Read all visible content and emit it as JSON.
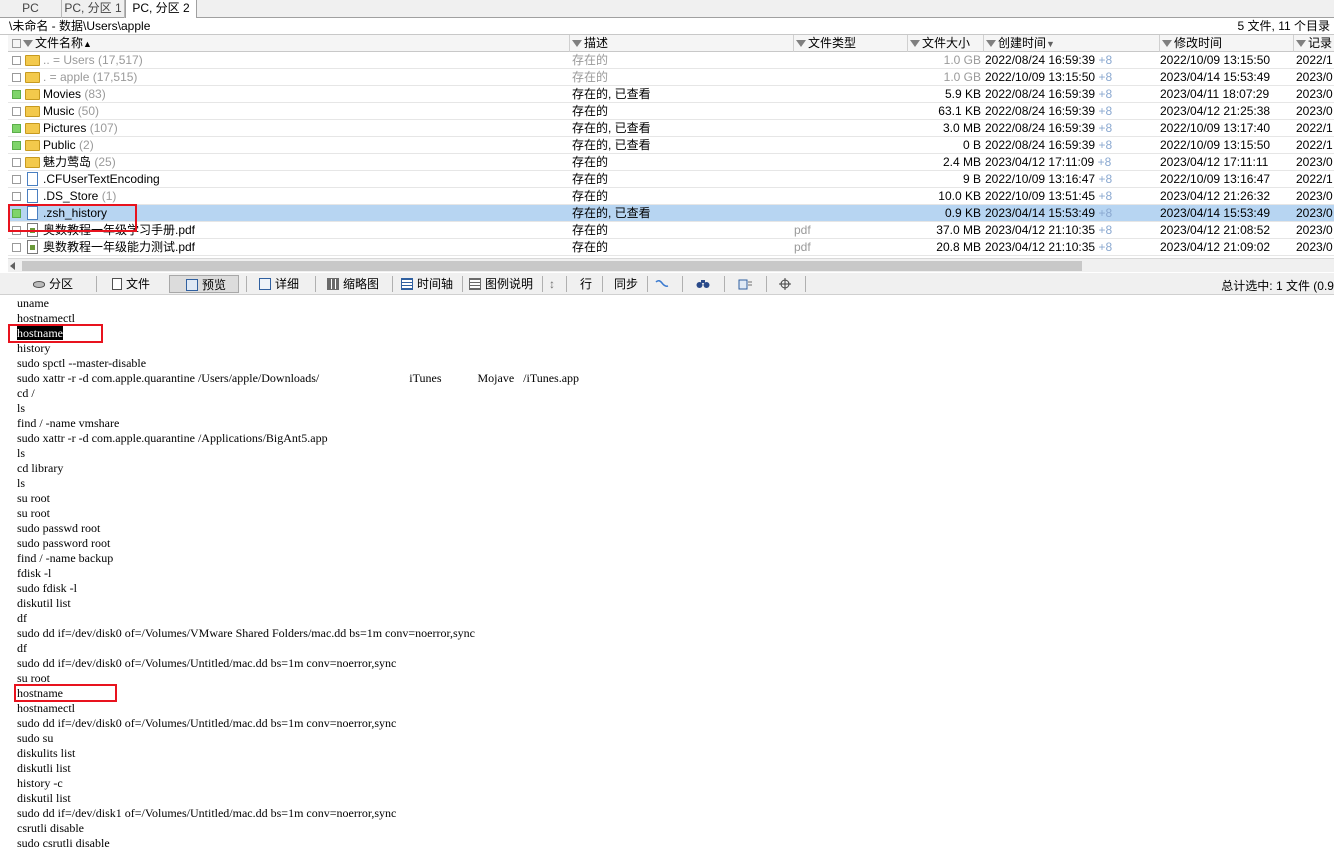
{
  "tabs": [
    "PC",
    "PC, 分区 1",
    "PC, 分区 2"
  ],
  "path": "\\未命名 - 数据\\Users\\apple",
  "summary": "5 文件, 11 个目录",
  "columns": [
    "文件名称",
    "描述",
    "文件类型",
    "文件大小",
    "创建时间",
    "修改时间",
    "记录"
  ],
  "rows": [
    {
      "name": "..   =   Users",
      "count": "(17,517)",
      "desc": "存在的",
      "type": "",
      "size": "1.0 GB",
      "created": "2022/08/24  16:59:39",
      "tz": "+8",
      "modified": "2022/10/09  13:15:50",
      "rec": "2022/1",
      "icon": "folder-icon",
      "check": "white",
      "gray": true
    },
    {
      "name": ".    =   apple",
      "count": "(17,515)",
      "desc": "存在的",
      "type": "",
      "size": "1.0 GB",
      "created": "2022/10/09  13:15:50",
      "tz": "+8",
      "modified": "2023/04/14  15:53:49",
      "rec": "2023/0",
      "icon": "folder-icon",
      "check": "white",
      "gray": true
    },
    {
      "name": "Movies",
      "count": "(83)",
      "desc": "存在的, 已查看",
      "type": "",
      "size": "5.9 KB",
      "created": "2022/08/24  16:59:39",
      "tz": "+8",
      "modified": "2023/04/11  18:07:29",
      "rec": "2023/0",
      "icon": "folder-icon",
      "check": "green",
      "gray": false
    },
    {
      "name": "Music",
      "count": "(50)",
      "desc": "存在的",
      "type": "",
      "size": "63.1 KB",
      "created": "2022/08/24  16:59:39",
      "tz": "+8",
      "modified": "2023/04/12  21:25:38",
      "rec": "2023/0",
      "icon": "folder-icon",
      "check": "white",
      "gray": false
    },
    {
      "name": "Pictures",
      "count": "(107)",
      "desc": "存在的, 已查看",
      "type": "",
      "size": "3.0 MB",
      "created": "2022/08/24  16:59:39",
      "tz": "+8",
      "modified": "2022/10/09  13:17:40",
      "rec": "2022/1",
      "icon": "folder-icon",
      "check": "green",
      "gray": false
    },
    {
      "name": "Public",
      "count": "(2)",
      "desc": "存在的, 已查看",
      "type": "",
      "size": "0 B",
      "created": "2022/08/24  16:59:39",
      "tz": "+8",
      "modified": "2022/10/09  13:15:50",
      "rec": "2022/1",
      "icon": "folder-icon",
      "check": "green",
      "gray": false
    },
    {
      "name": "魅力莺岛",
      "count": "(25)",
      "desc": "存在的",
      "type": "",
      "size": "2.4 MB",
      "created": "2023/04/12  17:11:09",
      "tz": "+8",
      "modified": "2023/04/12  17:11:11",
      "rec": "2023/0",
      "icon": "folder-icon",
      "check": "white",
      "gray": false
    },
    {
      "name": ".CFUserTextEncoding",
      "count": "",
      "desc": "存在的",
      "type": "",
      "size": "9 B",
      "created": "2022/10/09  13:16:47",
      "tz": "+8",
      "modified": "2022/10/09  13:16:47",
      "rec": "2022/1",
      "icon": "document-icon",
      "check": "white",
      "gray": false
    },
    {
      "name": ".DS_Store",
      "count": "(1)",
      "desc": "存在的",
      "type": "",
      "size": "10.0 KB",
      "created": "2022/10/09  13:51:45",
      "tz": "+8",
      "modified": "2023/04/12  21:26:32",
      "rec": "2023/0",
      "icon": "document-icon",
      "check": "white",
      "gray": false
    },
    {
      "name": ".zsh_history",
      "count": "",
      "desc": "存在的, 已查看",
      "type": "",
      "size": "0.9 KB",
      "created": "2023/04/14  15:53:49",
      "tz": "+8",
      "modified": "2023/04/14  15:53:49",
      "rec": "2023/0",
      "icon": "document-icon",
      "check": "green",
      "gray": false,
      "selected": true
    },
    {
      "name": "奥数教程一年级学习手册.pdf",
      "count": "",
      "desc": "存在的",
      "type": "pdf",
      "size": "37.0 MB",
      "created": "2023/04/12  21:10:35",
      "tz": "+8",
      "modified": "2023/04/12  21:08:52",
      "rec": "2023/0",
      "icon": "pdf-icon",
      "check": "white",
      "gray": false
    },
    {
      "name": "奥数教程一年级能力测试.pdf",
      "count": "",
      "desc": "存在的",
      "type": "pdf",
      "size": "20.8 MB",
      "created": "2023/04/12  21:10:35",
      "tz": "+8",
      "modified": "2023/04/12  21:09:02",
      "rec": "2023/0",
      "icon": "pdf-icon",
      "check": "white",
      "gray": false
    }
  ],
  "toolbar": {
    "partition": "分区",
    "file": "文件",
    "preview": "预览",
    "details": "详细",
    "thumbnails": "缩略图",
    "timeline": "时间轴",
    "legend": "图例说明",
    "row": "行",
    "sync": "同步",
    "status": "总计选中: 1 文件 (0.9"
  },
  "preview_lines": [
    "uname",
    "hostnamectl",
    "hostname",
    "history",
    "sudo spctl --master-disable",
    "sudo xattr -r -d com.apple.quarantine /Users/apple/Downloads/                              iTunes            Mojave   /iTunes.app",
    "cd /",
    "ls",
    "find / -name vmshare",
    "sudo xattr -r -d com.apple.quarantine /Applications/BigAnt5.app",
    "ls",
    "cd library",
    "ls",
    "su root",
    "su root",
    "sudo passwd root",
    "sudo password root",
    "find / -name backup",
    "fdisk -l",
    "sudo fdisk -l",
    "diskutil list",
    "df",
    "sudo dd if=/dev/disk0 of=/Volumes/VMware Shared Folders/mac.dd bs=1m conv=noerror,sync",
    "df",
    "sudo dd if=/dev/disk0 of=/Volumes/Untitled/mac.dd bs=1m conv=noerror,sync",
    "su root",
    "hostname",
    "hostnamectl",
    "sudo dd if=/dev/disk0 of=/Volumes/Untitled/mac.dd bs=1m conv=noerror,sync",
    "sudo su",
    "diskulits list",
    "diskutli list",
    "history -c",
    "diskutil list",
    "sudo dd if=/dev/disk1 of=/Volumes/Untitled/mac.dd bs=1m conv=noerror,sync",
    "csrutli disable",
    "sudo csrutli disable"
  ],
  "colors": {
    "selected_row": "#b7d5f2",
    "annotation": "#e8131e",
    "viewed_check": "#7fd46a"
  }
}
